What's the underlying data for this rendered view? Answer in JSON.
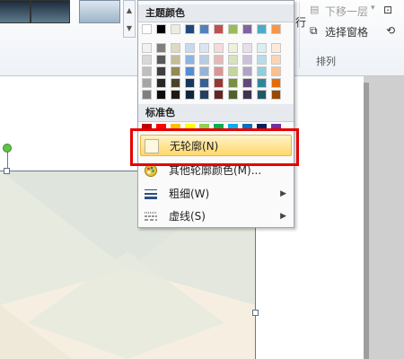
{
  "ribbon": {
    "send_backward": "下移一层",
    "send_backward_prefix": "行",
    "selection_pane": "选择窗格",
    "group_label": "排列"
  },
  "menu": {
    "theme_colors_header": "主题颜色",
    "standard_colors_header": "标准色",
    "items": [
      {
        "label": "无轮廓(N)",
        "icon": "no-outline-swatch",
        "has_submenu": false,
        "highlighted": true
      },
      {
        "label": "其他轮廓颜色(M)...",
        "icon": "color-palette-icon",
        "has_submenu": false,
        "highlighted": false
      },
      {
        "label": "粗细(W)",
        "icon": "line-weight-icon",
        "has_submenu": true,
        "highlighted": false
      },
      {
        "label": "虚线(S)",
        "icon": "dash-style-icon",
        "has_submenu": true,
        "highlighted": false
      }
    ],
    "submenu_arrow": "▶"
  },
  "theme_colors": {
    "top_row": [
      "#ffffff",
      "#000000",
      "#eeece1",
      "#1f497d",
      "#4f81bd",
      "#c0504d",
      "#9bbb59",
      "#8064a2",
      "#4bacc6",
      "#f79646"
    ],
    "shades": [
      [
        "#f2f2f2",
        "#7f7f7f",
        "#ddd9c3",
        "#c6d9f0",
        "#dbe5f1",
        "#f2dcdb",
        "#ebf1dd",
        "#e5e0ec",
        "#dbeef3",
        "#fdeada"
      ],
      [
        "#d8d8d8",
        "#595959",
        "#c4bd97",
        "#8db3e2",
        "#b8cce4",
        "#e5b9b7",
        "#d7e3bc",
        "#ccc1d9",
        "#b7dde8",
        "#fbd5b5"
      ],
      [
        "#bfbfbf",
        "#3f3f3f",
        "#938953",
        "#548dd4",
        "#95b3d7",
        "#d99694",
        "#c3d69b",
        "#b2a2c7",
        "#92cddc",
        "#fac08f"
      ],
      [
        "#a5a5a5",
        "#262626",
        "#494429",
        "#17365d",
        "#366092",
        "#953734",
        "#76923c",
        "#5f497a",
        "#31859b",
        "#e36c09"
      ],
      [
        "#7f7f7f",
        "#0c0c0c",
        "#1d1b10",
        "#0f243e",
        "#244061",
        "#632423",
        "#4f6128",
        "#3f3151",
        "#205867",
        "#974806"
      ]
    ]
  },
  "standard_colors": [
    "#c00000",
    "#ff0000",
    "#ffc000",
    "#ffff00",
    "#92d050",
    "#00b050",
    "#00b0f0",
    "#0070c0",
    "#002060",
    "#7030a0"
  ]
}
